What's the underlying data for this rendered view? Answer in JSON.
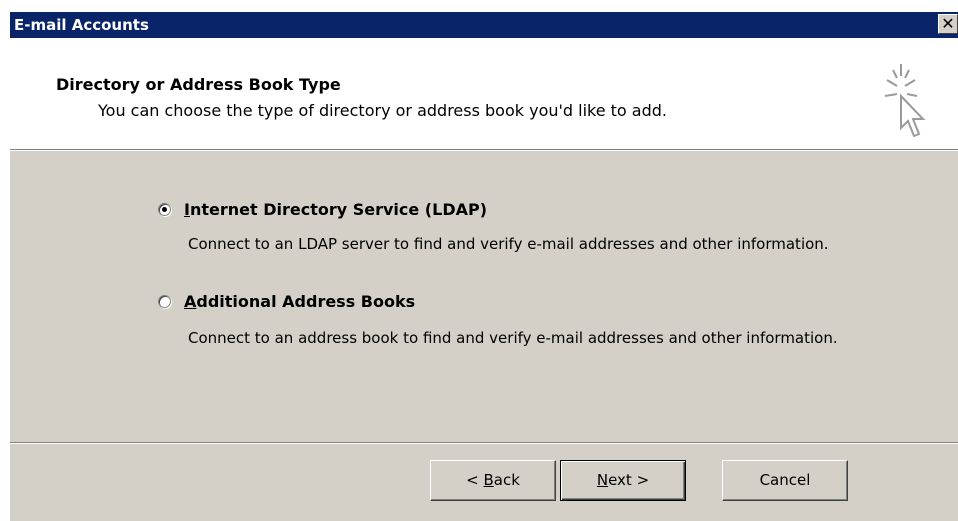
{
  "window": {
    "title": "E-mail Accounts",
    "close_glyph": "✕"
  },
  "header": {
    "title": "Directory or Address Book Type",
    "subtitle": "You can choose the type of directory or address book you'd like to add.",
    "icon": "wizard-sparkle-cursor-icon"
  },
  "options": [
    {
      "label_mnemonic": "I",
      "label_rest": "nternet Directory Service (LDAP)",
      "description": "Connect to an LDAP server to find and verify e-mail addresses and other information.",
      "selected": true
    },
    {
      "label_mnemonic": "A",
      "label_rest": "dditional Address Books",
      "description": "Connect to an address book to find and verify e-mail addresses and other information.",
      "selected": false
    }
  ],
  "buttons": {
    "back_prefix": "< ",
    "back_mnemonic": "B",
    "back_rest": "ack",
    "next_mnemonic": "N",
    "next_rest": "ext >",
    "cancel": "Cancel"
  }
}
